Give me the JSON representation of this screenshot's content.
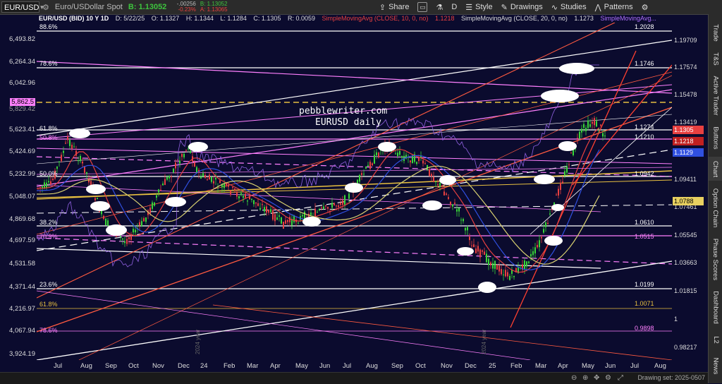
{
  "toolbar": {
    "symbol": "EUR/USD",
    "description": "Euro/USDollar Spot",
    "last": "B: 1.13052",
    "change_abs": "-.00256",
    "change_pct": "-0.23%",
    "bid": "B: 1.13052",
    "ask": "A: 1.13065",
    "share": "Share",
    "style": "Style",
    "drawings": "Drawings",
    "studies": "Studies",
    "patterns": "Patterns",
    "d_btn": "D"
  },
  "infobar": {
    "title": "EUR/USD (BID) 10 Y 1D",
    "date": "D: 5/22/25",
    "open": "O: 1.1327",
    "high": "H: 1.1344",
    "low": "L: 1.1284",
    "close": "C: 1.1305",
    "range": "R: 0.0059",
    "sma10": "SimpleMovingAvg (CLOSE, 10, 0, no)",
    "sma10_val": "1.1218",
    "sma20": "SimpleMovingAvg (CLOSE, 20, 0, no)",
    "sma20_val": "1.1273",
    "sma3": "SimpleMovingAvg..."
  },
  "left_axis": [
    "6,493.82",
    "6,264.34",
    "6,042.96",
    "5,862.5",
    "5,829.42",
    "5,623.41",
    "5,424.69",
    "5,232.99",
    "5,048.07",
    "4,869.68",
    "4,697.59",
    "4,531.58",
    "4,371.44",
    "4,216.97",
    "4,067.94",
    "3,924.19"
  ],
  "left_fibs": [
    {
      "label": "88.6%",
      "color": "#ffffff"
    },
    {
      "label": "78.6%",
      "color": "#ffffff"
    },
    {
      "label": "61.8%",
      "color": "#ffffff"
    },
    {
      "label": "50.8%",
      "color": "#ff80ff"
    },
    {
      "label": "50.0%",
      "color": "#ffffff"
    },
    {
      "label": "38.2%",
      "color": "#ffffff"
    },
    {
      "label": "70.9%",
      "color": "#ff80ff"
    },
    {
      "label": "23.6%",
      "color": "#ffffff"
    },
    {
      "label": "61.8%",
      "color": "#e8c040"
    },
    {
      "label": "78.6%",
      "color": "#ff80ff"
    }
  ],
  "right_fib_labels": [
    {
      "label": "1.2028",
      "color": "#ffffff"
    },
    {
      "label": "1.1746",
      "color": "#ffffff"
    },
    {
      "label": "1.1274",
      "color": "#ffffff"
    },
    {
      "label": "1.1210",
      "color": "#ffffff"
    },
    {
      "label": "1.0942",
      "color": "#ffffff"
    },
    {
      "label": "1.0610",
      "color": "#ffffff"
    },
    {
      "label": "1.0515",
      "color": "#ff80ff"
    },
    {
      "label": "1.0199",
      "color": "#ffffff"
    },
    {
      "label": "1.0071",
      "color": "#e8c040"
    },
    {
      "label": "0.9898",
      "color": "#ff80ff"
    }
  ],
  "right_axis": [
    "1.19709",
    "1.17574",
    "1.15478",
    "1.13419",
    "1.09411",
    "1.07461",
    "1.05545",
    "1.03663",
    "1.01815",
    "1",
    "0.98217"
  ],
  "right_badges": [
    {
      "label": "1.1305",
      "bg": "#e84040",
      "color": "#ffffff"
    },
    {
      "label": "1.1218",
      "bg": "#c02020",
      "color": "#ffffff"
    },
    {
      "label": "1.1129",
      "bg": "#3050e0",
      "color": "#ffffff"
    },
    {
      "label": "1.0788",
      "bg": "#e8d060",
      "color": "#000000"
    }
  ],
  "left_badge": {
    "label": "5,862.5",
    "bg": "#ff80ff"
  },
  "xaxis": [
    "Jul",
    "Aug",
    "Sep",
    "Oct",
    "Nov",
    "Dec",
    "24",
    "Feb",
    "Mar",
    "Apr",
    "May",
    "Jun",
    "Jul",
    "Aug",
    "Sep",
    "Oct",
    "Nov",
    "Dec",
    "25",
    "Feb",
    "Mar",
    "Apr",
    "May",
    "Jun",
    "Jul",
    "Aug"
  ],
  "watermark": {
    "line1": "pebblewriter.com",
    "line2": "EURUSD daily"
  },
  "year_labels": [
    "2024 year",
    "2024 year"
  ],
  "side_tabs": [
    "Trade",
    "T&S",
    "Active Trader",
    "Buttons",
    "Chart",
    "Option Chain",
    "Phase Scores",
    "Dashboard",
    "L2",
    "News"
  ],
  "status": "Drawing set: 2025-0507",
  "colors": {
    "bg": "#0b0b2e",
    "accent_red": "#e84040",
    "accent_pink": "#ff80ff",
    "accent_gold": "#e8c040",
    "sma_blue": "#3050e0"
  }
}
